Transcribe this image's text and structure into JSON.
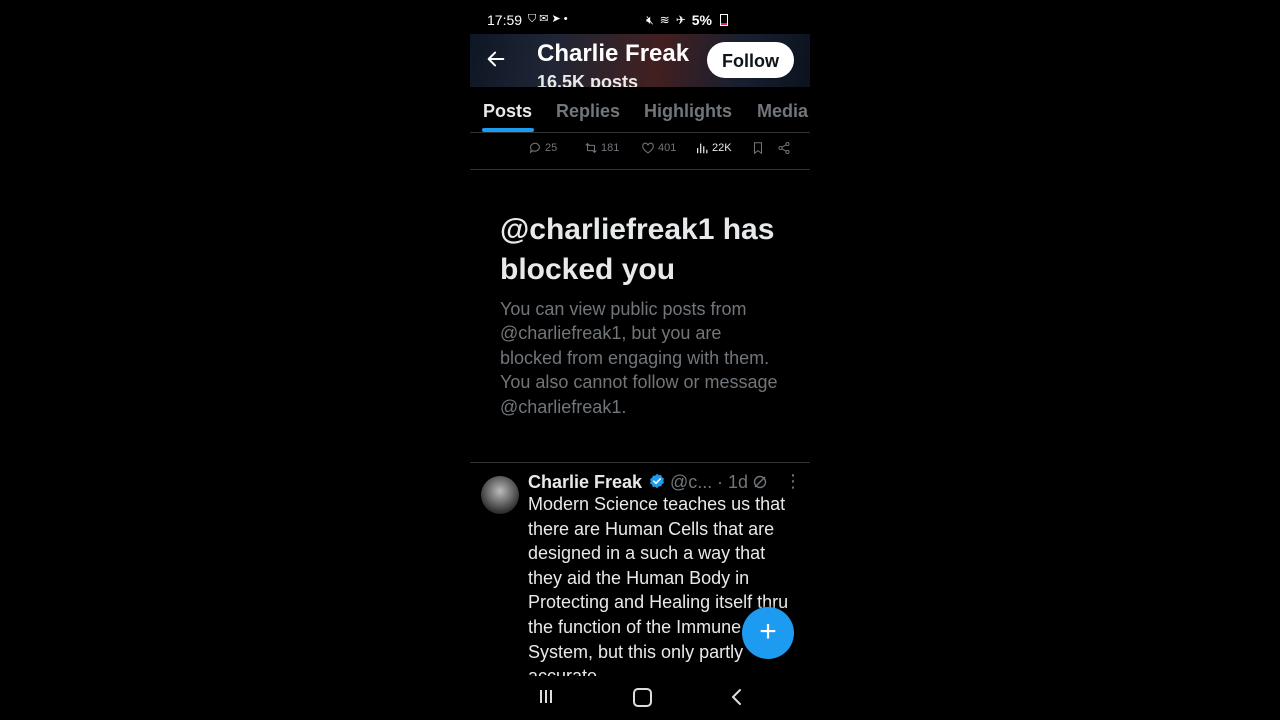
{
  "status_bar": {
    "time": "17:59",
    "left_icons": [
      "shield-icon",
      "mail-icon",
      "send-icon",
      "dot-icon"
    ],
    "right_icons": [
      "mute-icon",
      "wifi-icon",
      "airplane-icon"
    ],
    "battery": "5%",
    "battery_color": "#e0245e"
  },
  "header": {
    "back_icon": "arrow-left-icon",
    "name": "Charlie Freak",
    "posts_count": "16.5K posts",
    "follow_label": "Follow"
  },
  "tabs": [
    {
      "label": "Posts",
      "active": true
    },
    {
      "label": "Replies",
      "active": false
    },
    {
      "label": "Highlights",
      "active": false
    },
    {
      "label": "Media",
      "active": false
    }
  ],
  "previous_post_actions": {
    "replies": "25",
    "reposts": "181",
    "likes": "401",
    "views": "22K"
  },
  "blocked_notice": {
    "title": "@charliefreak1 has blocked you",
    "body": "You can view public posts from @charliefreak1, but you are blocked from engaging with them. You also cannot follow or message @charliefreak1."
  },
  "tweet": {
    "name": "Charlie Freak",
    "handle": "@c...",
    "time": "· 1d",
    "text": "Modern Science teaches us that there are Human Cells that are designed in a such a way that they aid the Human Body in Protecting and Healing itself thru the function of the Immune System, but this only partly accurate."
  },
  "colors": {
    "accent": "#1d9bf0",
    "background": "#000000",
    "text_primary": "#e7e9ea",
    "text_secondary": "#71767b",
    "divider": "#2f3336"
  },
  "fab_icon": "plus-icon",
  "nav_icons": [
    "recent-apps-icon",
    "home-icon",
    "back-icon"
  ]
}
